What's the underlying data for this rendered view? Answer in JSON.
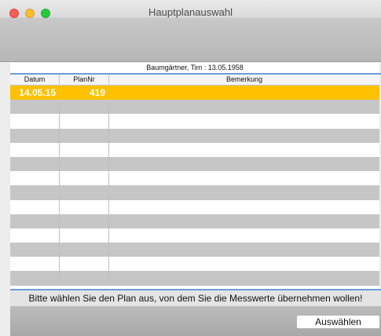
{
  "window": {
    "title": "Hauptplanauswahl"
  },
  "patient": {
    "header": "Baumgärtner,  Tim : 13.05.1958"
  },
  "table": {
    "columns": [
      "Datum",
      "PlanNr",
      "Bemerkung"
    ],
    "rows": [
      {
        "datum": "14.05.15",
        "plannr": "419",
        "bemerkung": "",
        "selected": true
      }
    ],
    "visible_row_count": 14
  },
  "instruction": "Bitte wählen Sie den Plan aus, von dem Sie die Messwerte übernehmen wollen!",
  "buttons": {
    "select": "Auswählen"
  },
  "colors": {
    "selection": "#fdc100",
    "row_alt": "#c6c6c6",
    "accent_line": "#6a9ed8",
    "traffic_close": "#fc5f57",
    "traffic_minimize": "#fdbc2e",
    "traffic_maximize": "#28c940"
  }
}
